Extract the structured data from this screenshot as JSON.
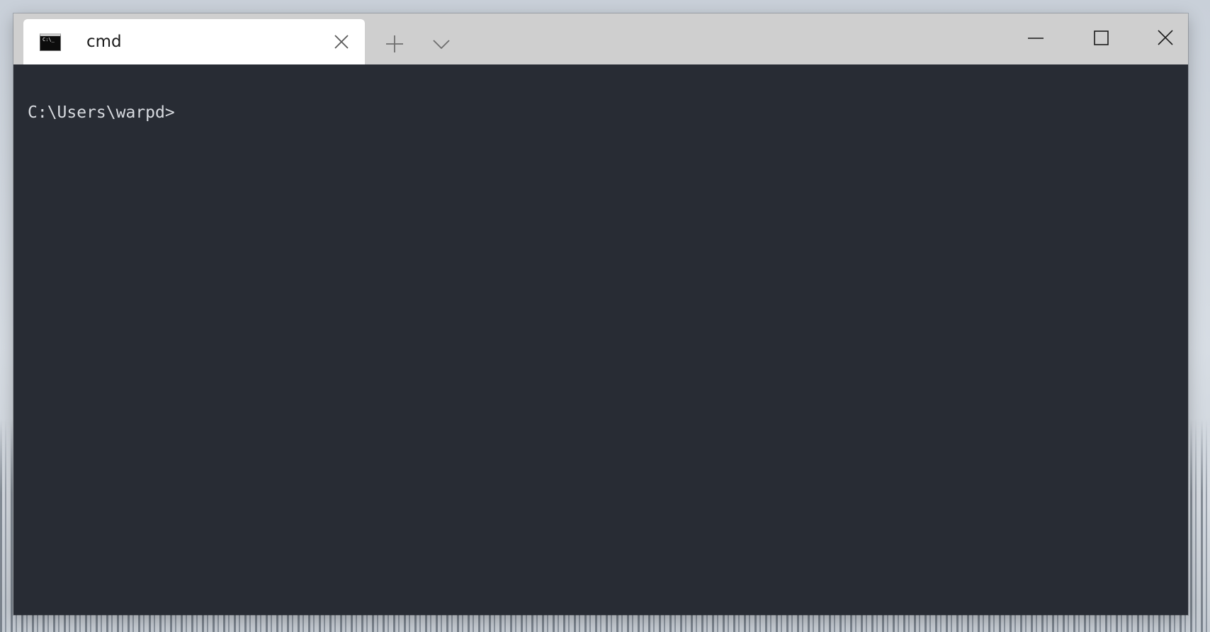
{
  "tabs": [
    {
      "title": "cmd",
      "icon": "cmd-prompt-icon",
      "active": true
    }
  ],
  "titlebar": {
    "new_tab_icon": "plus-icon",
    "dropdown_icon": "chevron-down-icon",
    "minimize_icon": "minimize-icon",
    "maximize_icon": "maximize-icon",
    "close_icon": "close-icon"
  },
  "terminal": {
    "prompt": "C:\\Users\\warpd>"
  },
  "colors": {
    "titlebar": "#cfcfcf",
    "tab_active": "#ffffff",
    "terminal_bg": "#282c34",
    "terminal_fg": "#d8dbe0"
  }
}
